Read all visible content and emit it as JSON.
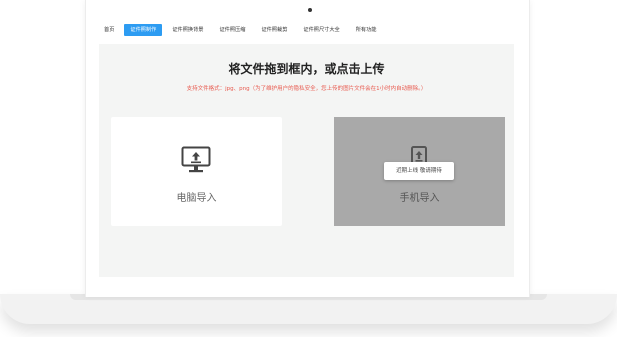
{
  "nav": {
    "items": [
      {
        "label": "首页"
      },
      {
        "label": "证件照制作"
      },
      {
        "label": "证件照换背景"
      },
      {
        "label": "证件照压缩"
      },
      {
        "label": "证件照裁剪"
      },
      {
        "label": "证件照尺寸大全"
      },
      {
        "label": "所有功能"
      }
    ],
    "active_index": 1,
    "active_color": "#2d9cf2"
  },
  "upload": {
    "title": "将文件拖到框内，或点击上传",
    "hint": "支持文件格式：jpg、png（为了维护用户的隐私安全，您上传的图片文件会在1小时内自动删除。）",
    "hint_color": "#e85a4f",
    "pc": {
      "label": "电脑导入",
      "icon": "monitor-upload-icon"
    },
    "phone": {
      "label": "手机导入",
      "icon": "phone-upload-icon",
      "tooltip": "近期上线 敬请期待"
    }
  }
}
